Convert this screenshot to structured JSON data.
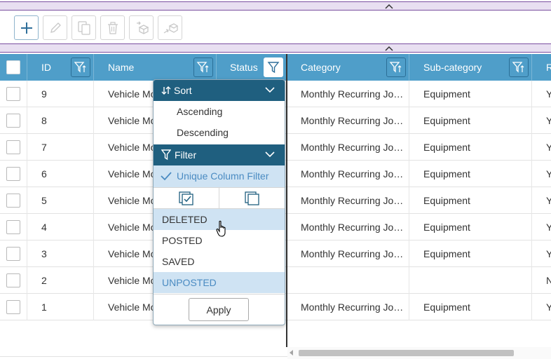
{
  "icons": {
    "collapse": "chevron-up-icon",
    "add": "plus-icon",
    "edit": "pencil-icon",
    "copy": "copy-icon",
    "delete": "trash-icon",
    "move_in": "move-in-icon",
    "move_out": "move-out-icon",
    "filter": "filter-icon",
    "sort": "sort-icon"
  },
  "colors": {
    "header": "#4f9ec9",
    "menu_section": "#1f5f7f",
    "highlight": "#cfe3f3",
    "accent_text": "#4a8bc2",
    "splitter": "#e8dff1"
  },
  "grid": {
    "columns": {
      "id": "ID",
      "name": "Name",
      "status": "Status",
      "category": "Category",
      "subcategory": "Sub-category",
      "next": "R"
    },
    "rows": [
      {
        "id": "9",
        "name": "Vehicle Mo",
        "category": "Monthly Recurring Journal",
        "subcategory": "Equipment",
        "next": "Y"
      },
      {
        "id": "8",
        "name": "Vehicle Mo",
        "category": "Monthly Recurring Journal",
        "subcategory": "Equipment",
        "next": "Y"
      },
      {
        "id": "7",
        "name": "Vehicle Mo",
        "category": "Monthly Recurring Journal",
        "subcategory": "Equipment",
        "next": "Y"
      },
      {
        "id": "6",
        "name": "Vehicle Mo",
        "category": "Monthly Recurring Journal",
        "subcategory": "Equipment",
        "next": "Y"
      },
      {
        "id": "5",
        "name": "Vehicle Mo",
        "category": "Monthly Recurring Journal",
        "subcategory": "Equipment",
        "next": "Y"
      },
      {
        "id": "4",
        "name": "Vehicle Mo",
        "category": "Monthly Recurring Journal",
        "subcategory": "Equipment",
        "next": "Y"
      },
      {
        "id": "3",
        "name": "Vehicle Mo",
        "category": "Monthly Recurring Journal",
        "subcategory": "Equipment",
        "next": "Y"
      },
      {
        "id": "2",
        "name": "Vehicle Mo",
        "category": "",
        "subcategory": "",
        "next": "N"
      },
      {
        "id": "1",
        "name": "Vehicle Mo",
        "category": "Monthly Recurring Journal",
        "subcategory": "Equipment",
        "next": "Y"
      }
    ]
  },
  "menu": {
    "sort_label": "Sort",
    "ascending": "Ascending",
    "descending": "Descending",
    "filter_label": "Filter",
    "unique_filter": "Unique Column Filter",
    "options": [
      "DELETED",
      "POSTED",
      "SAVED",
      "UNPOSTED"
    ],
    "apply": "Apply"
  }
}
